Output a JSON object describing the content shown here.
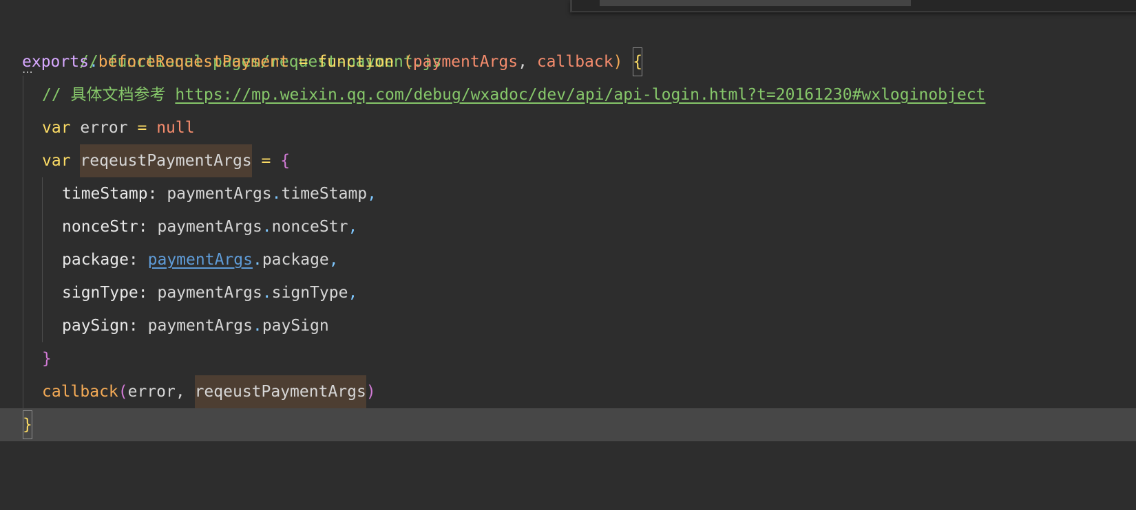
{
  "editor": {
    "line1": {
      "comment": "// functional-pages/request-payment.js"
    },
    "line2": {
      "object": "exports",
      "dot": ".",
      "method": "beforeRequestPayment",
      "assign": " = ",
      "keyword": "function",
      "open_paren": " (",
      "param1": "paymentArgs",
      "comma": ", ",
      "param2": "callback",
      "close_paren": ") ",
      "brace": "{"
    },
    "line3": {
      "comment_prefix": "// 具体文档参考 ",
      "url": "https://mp.weixin.qq.com/debug/wxadoc/dev/api/api-login.html?t=20161230#wxloginobject"
    },
    "line4": {
      "keyword": "var",
      "name": " error ",
      "op": "= ",
      "value": "null"
    },
    "line5": {
      "keyword": "var",
      "space": " ",
      "name": "reqeustPaymentArgs",
      "op": " = ",
      "brace": "{"
    },
    "line6": {
      "prop": "timeStamp:",
      "obj": " paymentArgs",
      "dot": ".",
      "field": "timeStamp",
      "tail": ","
    },
    "line7": {
      "prop": "nonceStr:",
      "obj": " paymentArgs",
      "dot": ".",
      "field": "nonceStr",
      "tail": ","
    },
    "line8": {
      "prop": "package:",
      "space": " ",
      "obj": "paymentArgs",
      "dot": ".",
      "field": "package",
      "tail": ","
    },
    "line9": {
      "prop": "signType:",
      "obj": " paymentArgs",
      "dot": ".",
      "field": "signType",
      "tail": ","
    },
    "line10": {
      "prop": "paySign:",
      "obj": " paymentArgs",
      "dot": ".",
      "field": "paySign"
    },
    "line11": {
      "brace": "}"
    },
    "line12": {
      "fn": "callback",
      "open": "(",
      "arg1": "error, ",
      "arg2": "reqeustPaymentArgs",
      "close": ")"
    },
    "line13": {
      "brace": "}"
    },
    "fold_marker": "⋯"
  },
  "colors": {
    "background": "#2d2d2d",
    "current_line": "#474747",
    "comment": "#86c76a",
    "keyword": "#fbdb65",
    "function": "#f5ab56",
    "parameter": "#f58c6d",
    "object": "#d7a8ff",
    "link": "#5f9cd8",
    "highlight": "#4d3e32"
  }
}
